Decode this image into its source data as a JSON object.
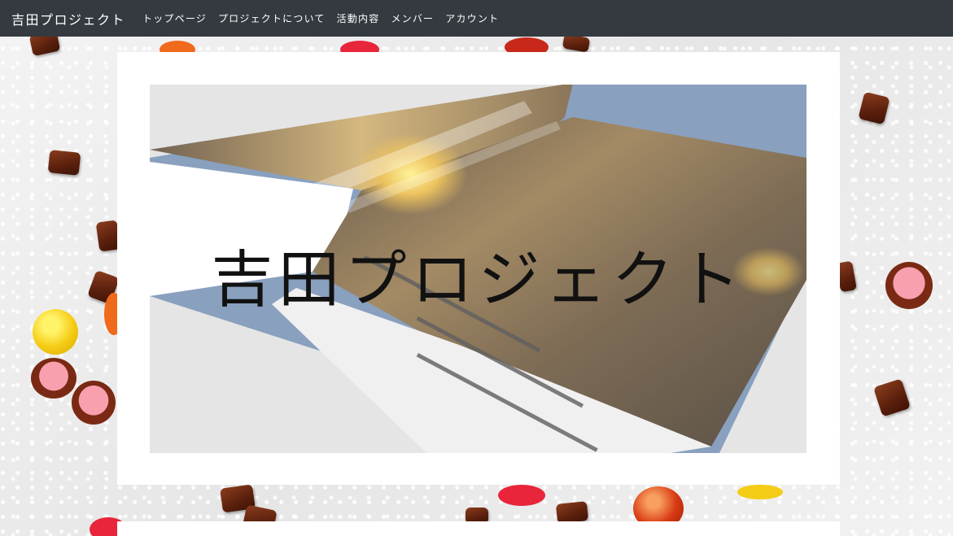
{
  "navbar": {
    "brand": "吉田プロジェクト",
    "links": [
      "トップページ",
      "プロジェクトについて",
      "活動内容",
      "メンバー",
      "アカウント"
    ]
  },
  "hero": {
    "title": "吉田プロジェクト",
    "image_alt_icon": "open-book-image"
  },
  "colors": {
    "navbar_bg": "#343a40",
    "nav_text": "#ffffff",
    "card_bg": "#ffffff"
  }
}
